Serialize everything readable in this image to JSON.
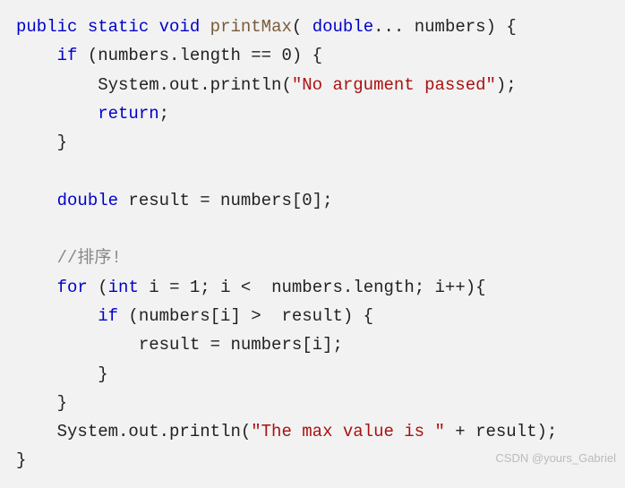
{
  "code": {
    "kw_public": "public",
    "kw_static": "static",
    "kw_void": "void",
    "method_name": "printMax",
    "paren_open": "( ",
    "kw_double": "double",
    "varargs": "... numbers) {",
    "line2_prefix": "    ",
    "kw_if": "if",
    "line2_cond": " (numbers.length == ",
    "zero": "0",
    "line2_end": ") {",
    "line3_prefix": "        System.out.println(",
    "str_noarg": "\"No argument passed\"",
    "line3_end": ");",
    "line4_prefix": "        ",
    "kw_return": "return",
    "semicolon": ";",
    "line5": "    }",
    "blank": "",
    "line7_prefix": "    ",
    "kw_double2": "double",
    "line7_rest": " result = numbers[",
    "zero2": "0",
    "line7_end": "];",
    "comment_prefix": "    ",
    "comment": "//排序!",
    "line10_prefix": "    ",
    "kw_for": "for",
    "line10_open": " (",
    "kw_int": "int",
    "line10_init": " i = ",
    "one": "1",
    "line10_rest": "; i <  numbers.length; i++){",
    "line11_prefix": "        ",
    "kw_if2": "if",
    "line11_cond": " (numbers[i] >  result) {",
    "line12": "            result = numbers[i];",
    "line13": "        }",
    "line14": "    }",
    "line15_prefix": "    System.out.println(",
    "str_max": "\"The max value is \"",
    "line15_end": " + result);",
    "line16": "}"
  },
  "watermark": "CSDN @yours_Gabriel"
}
